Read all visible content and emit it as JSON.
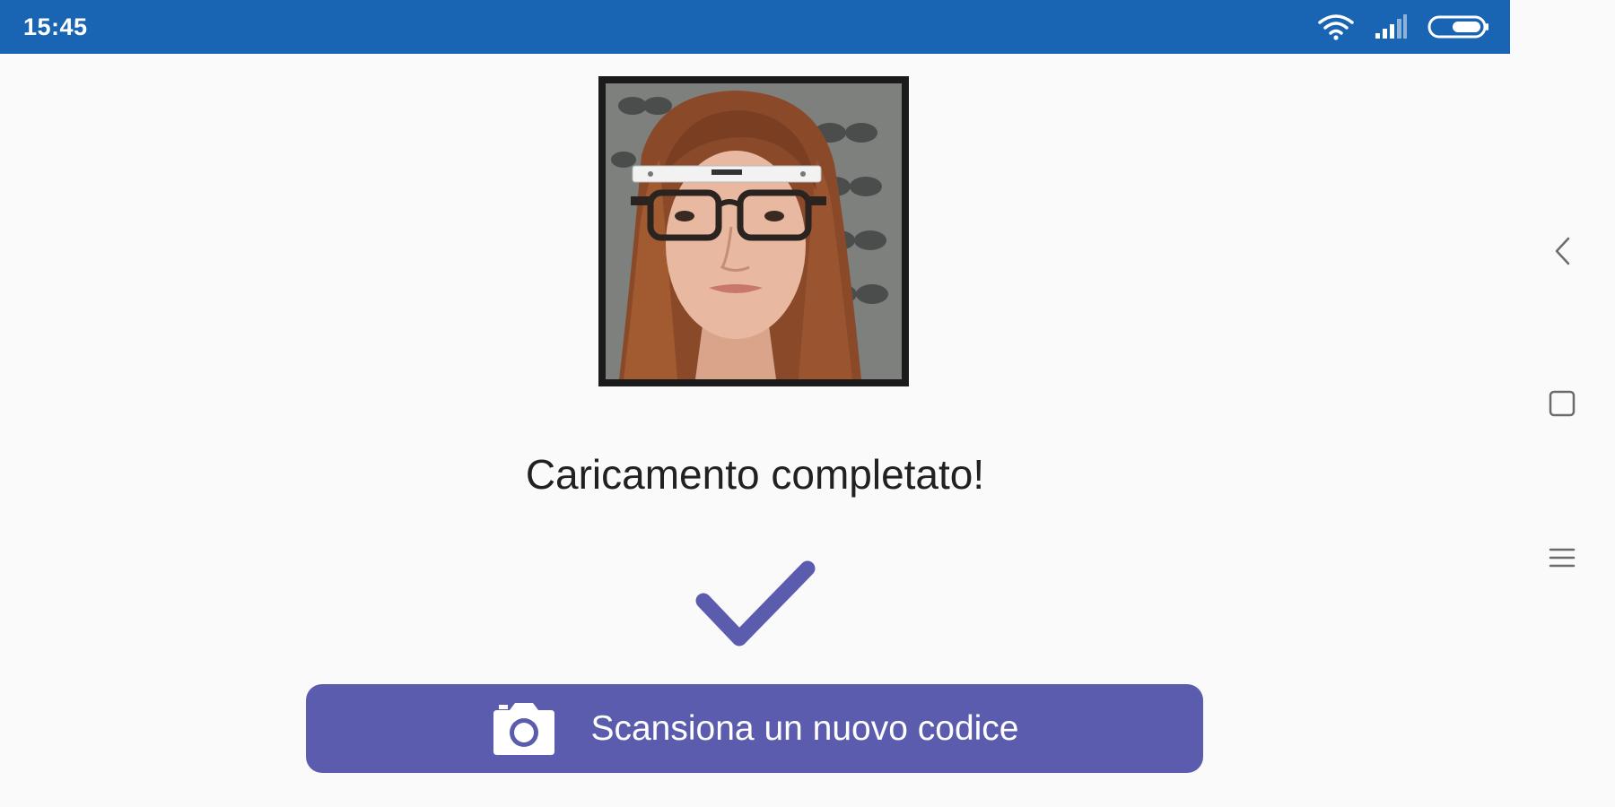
{
  "status_bar": {
    "time": "15:45",
    "icons": [
      "wifi-icon",
      "signal-icon",
      "battery-icon"
    ],
    "background": "#1a65b3"
  },
  "nav_bar": {
    "buttons": [
      "back-icon",
      "home-icon",
      "menu-icon"
    ]
  },
  "main": {
    "photo_alt": "photo-of-face-with-glasses",
    "status_message": "Caricamento completato!",
    "status_icon": "checkmark-icon",
    "scan_button": {
      "label": "Scansiona un nuovo codice",
      "icon": "camera-icon"
    }
  },
  "colors": {
    "accent": "#5b5cae",
    "status_bar": "#1a65b3",
    "background": "#fafafa",
    "text": "#212121"
  }
}
